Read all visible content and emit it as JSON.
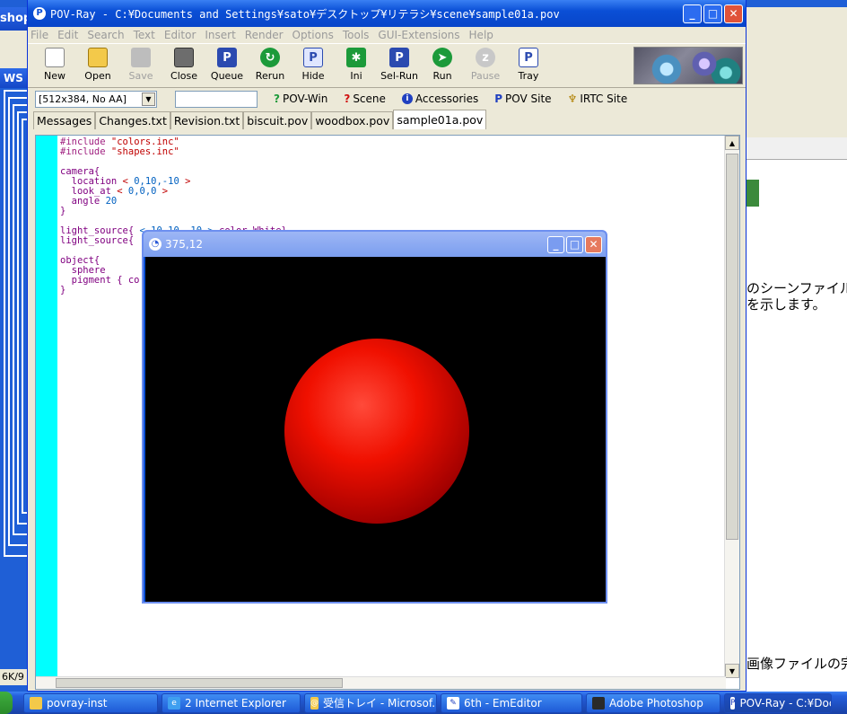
{
  "bg_left": {
    "title_fragment": "shop",
    "title_fragment2": "WS",
    "status_fragment": "6K/9"
  },
  "bg_right": {
    "jp_line1": "のシーンファイル",
    "jp_line2": "を示します。",
    "jp_line3": "画像ファイルの完"
  },
  "main": {
    "title": "POV-Ray - C:¥Documents and Settings¥sato¥デスクトップ¥リテラシ¥scene¥sample01a.pov",
    "menu": [
      "File",
      "Edit",
      "Search",
      "Text",
      "Editor",
      "Insert",
      "Render",
      "Options",
      "Tools",
      "GUI-Extensions",
      "Help"
    ],
    "toolbar": [
      {
        "label": "New",
        "icon": "new-icon"
      },
      {
        "label": "Open",
        "icon": "open-icon"
      },
      {
        "label": "Save",
        "icon": "save-icon",
        "disabled": true
      },
      {
        "label": "Close",
        "icon": "close-file-icon"
      },
      {
        "label": "Queue",
        "icon": "queue-icon"
      },
      {
        "label": "Rerun",
        "icon": "rerun-icon"
      },
      {
        "label": "Hide",
        "icon": "hide-icon"
      },
      {
        "label": "Ini",
        "icon": "ini-icon"
      },
      {
        "label": "Sel-Run",
        "icon": "sel-run-icon"
      },
      {
        "label": "Run",
        "icon": "run-icon"
      },
      {
        "label": "Pause",
        "icon": "pause-icon",
        "disabled": true
      },
      {
        "label": "Tray",
        "icon": "tray-icon"
      }
    ],
    "resolution": "[512x384, No AA]",
    "links": [
      {
        "label": "POV-Win",
        "icon": "help-icon"
      },
      {
        "label": "Scene",
        "icon": "help-icon"
      },
      {
        "label": "Accessories",
        "icon": "info-icon"
      },
      {
        "label": "POV Site",
        "icon": "pov-icon"
      },
      {
        "label": "IRTC Site",
        "icon": "trophy-icon"
      }
    ],
    "tabs": [
      "Messages",
      "Changes.txt",
      "Revision.txt",
      "biscuit.pov",
      "woodbox.pov",
      "sample01a.pov"
    ],
    "active_tab": "sample01a.pov",
    "code": {
      "l1a": "#include ",
      "l1b": "\"colors.inc\"",
      "l2a": "#include ",
      "l2b": "\"shapes.inc\"",
      "l4": "camera{",
      "l5a": "  location ",
      "l5b": "< ",
      "l5c": "0,10,-10",
      "l5d": " >",
      "l6a": "  look_at ",
      "l6b": "< ",
      "l6c": "0,0,0",
      "l6d": " >",
      "l7a": "  angle ",
      "l7b": "20",
      "l8": "}",
      "l10a": "light_source{ ",
      "l10b": "< 10,10,-10 >",
      "l10c": " color White}",
      "l11": "light_source{",
      "l13": "object{",
      "l14": "  sphere",
      "l15a": "  pigment { ",
      "l15b": "co",
      "l16": "}"
    }
  },
  "render": {
    "title": "375,12"
  },
  "taskbar": [
    {
      "label": "povray-inst",
      "icon": "folder-icon"
    },
    {
      "label": "2 Internet Explorer",
      "icon": "ie-icon"
    },
    {
      "label": "受信トレイ - Microsof...",
      "icon": "outlook-icon"
    },
    {
      "label": "6th - EmEditor",
      "icon": "emeditor-icon"
    },
    {
      "label": "Adobe Photoshop",
      "icon": "photoshop-icon"
    },
    {
      "label": "POV-Ray - C:¥Doc",
      "icon": "povray-icon"
    }
  ]
}
